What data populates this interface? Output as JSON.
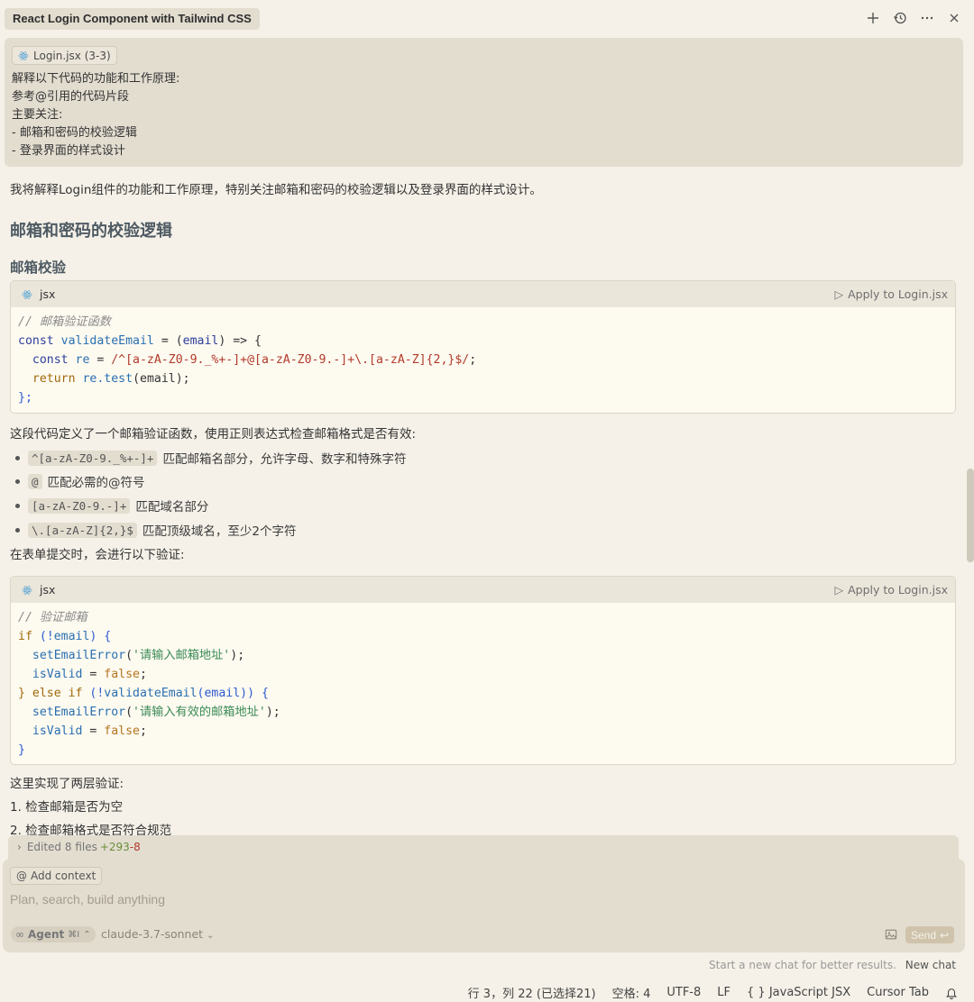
{
  "header": {
    "title": "React Login Component with Tailwind CSS",
    "icons": [
      "plus-icon",
      "history-icon",
      "more-icon",
      "close-icon"
    ]
  },
  "user_message": {
    "context_chip": "Login.jsx (3-3)",
    "lines": [
      "解释以下代码的功能和工作原理:",
      "参考@引用的代码片段",
      "主要关注:",
      "- 邮箱和密码的校验逻辑",
      "- 登录界面的样式设计"
    ]
  },
  "assistant": {
    "intro": "我将解释Login组件的功能和工作原理，特别关注邮箱和密码的校验逻辑以及登录界面的样式设计。",
    "heading1": "邮箱和密码的校验逻辑",
    "heading2": "邮箱校验",
    "code1": {
      "lang": "jsx",
      "apply": "Apply to Login.jsx",
      "comment": "// 邮箱验证函数",
      "l2a": "const",
      "l2b": "validateEmail",
      "l2c": " = (",
      "l2d": "email",
      "l2e": ") => {",
      "l3a": "  const",
      "l3b": " re",
      "l3c": " = ",
      "l3d": "/^[a-zA-Z0-9._%+-]+@[a-zA-Z0-9.-]+\\.[a-zA-Z]{2,}$/",
      "l3e": ";",
      "l4a": "  return",
      "l4b": " re.test",
      "l4c": "(email);",
      "l5": "};"
    },
    "para1": "这段代码定义了一个邮箱验证函数，使用正则表达式检查邮箱格式是否有效:",
    "bullets": [
      {
        "code": "^[a-zA-Z0-9._%+-]+",
        "text": "匹配邮箱名部分，允许字母、数字和特殊字符"
      },
      {
        "code": "@",
        "text": "匹配必需的@符号"
      },
      {
        "code": "[a-zA-Z0-9.-]+",
        "text": "匹配域名部分"
      },
      {
        "code": "\\.[a-zA-Z]{2,}$",
        "text": "匹配顶级域名，至少2个字符"
      }
    ],
    "para2": "在表单提交时，会进行以下验证:",
    "code2": {
      "lang": "jsx",
      "apply": "Apply to Login.jsx",
      "comment": "// 验证邮箱",
      "l2a": "if",
      "l2b": " (!",
      "l2c": "email",
      "l2d": ") {",
      "l3a": "  setEmailError",
      "l3b": "(",
      "l3c": "'请输入邮箱地址'",
      "l3d": ");",
      "l4a": "  isValid",
      "l4b": " = ",
      "l4c": "false",
      "l4d": ";",
      "l5a": "} else if",
      "l5b": " (!",
      "l5c": "validateEmail",
      "l5d": "(email)) {",
      "l6a": "  setEmailError",
      "l6b": "(",
      "l6c": "'请输入有效的邮箱地址'",
      "l6d": ");",
      "l7a": "  isValid",
      "l7b": " = ",
      "l7c": "false",
      "l7d": ";",
      "l8": "}"
    },
    "para3": "这里实现了两层验证:",
    "list": [
      "1. 检查邮箱是否为空",
      "2. 检查邮箱格式是否符合规范"
    ]
  },
  "edited": {
    "label": "Edited 8 files",
    "added": "+293",
    "removed": "-8"
  },
  "composer": {
    "add_context": "Add context",
    "placeholder": "Plan, search, build anything",
    "agent_label": "Agent",
    "agent_shortcut": "⌘I",
    "model": "claude-3.7-sonnet",
    "send": "Send"
  },
  "hint": {
    "text": "Start a new chat for better results.",
    "link": "New chat"
  },
  "statusbar": {
    "position": "行 3，列 22 (已选择21)",
    "indent": "空格: 4",
    "encoding": "UTF-8",
    "eol": "LF",
    "language": "{ } JavaScript JSX",
    "cursor_tab": "Cursor Tab"
  }
}
